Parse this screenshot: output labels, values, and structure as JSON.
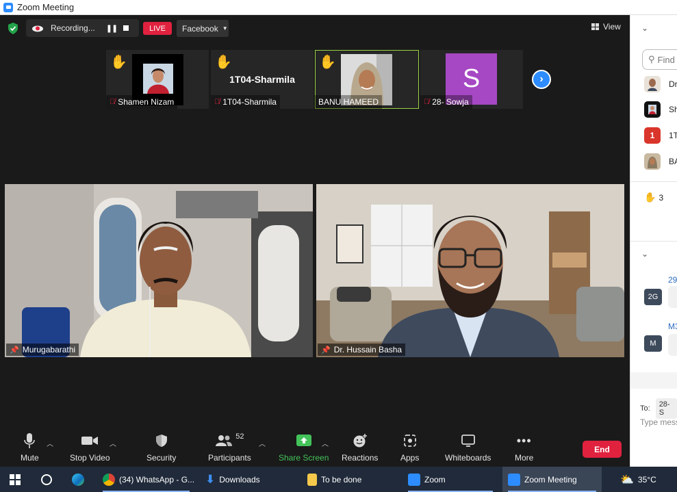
{
  "window": {
    "title": "Zoom Meeting"
  },
  "topbar": {
    "recording_label": "Recording...",
    "live_badge": "LIVE",
    "stream_target": "Facebook",
    "view_label": "View"
  },
  "thumbnails": [
    {
      "name": "Shamen Nizam",
      "hand": "✋",
      "muted": true
    },
    {
      "name": "1T04-Sharmila",
      "display_name": "1T04-Sharmila",
      "hand": "✋",
      "muted": true
    },
    {
      "name": "BANU HAMEED",
      "hand": "✋",
      "muted": false,
      "selected": true
    },
    {
      "name": "28- Sowja",
      "avatar_letter": "S",
      "muted": true,
      "avatar_color": "#a648c4"
    }
  ],
  "videos": [
    {
      "name": "Murugabarathi"
    },
    {
      "name": "Dr. Hussain Basha"
    }
  ],
  "toolbar": {
    "mute": "Mute",
    "stop_video": "Stop Video",
    "security": "Security",
    "participants": "Participants",
    "participants_count": "52",
    "share_screen": "Share Screen",
    "reactions": "Reactions",
    "apps": "Apps",
    "whiteboards": "Whiteboards",
    "more": "More",
    "end": "End"
  },
  "side_panel": {
    "search_placeholder": "Find",
    "participants": [
      {
        "name_fragment": "Dr"
      },
      {
        "name_fragment": "Sh"
      },
      {
        "name_fragment": "1T",
        "badge": "1"
      },
      {
        "name_fragment": "BA"
      }
    ],
    "raised_hands": "3",
    "chat": [
      {
        "avatar": "2G",
        "time_fragment": "29"
      },
      {
        "avatar": "M",
        "time_fragment": "M3"
      }
    ],
    "to_label": "To:",
    "to_value": "28- S",
    "message_placeholder": "Type mess"
  },
  "taskbar": {
    "items": [
      {
        "label": "(34) WhatsApp - G..."
      },
      {
        "label": "Downloads"
      },
      {
        "label": "To be done"
      },
      {
        "label": "Zoom"
      },
      {
        "label": "Zoom Meeting"
      }
    ],
    "temperature": "35°C"
  },
  "colors": {
    "accent_blue": "#2d8cff",
    "live_red": "#e0223f",
    "share_green": "#43c35a",
    "selected_outline": "#9bd249"
  }
}
